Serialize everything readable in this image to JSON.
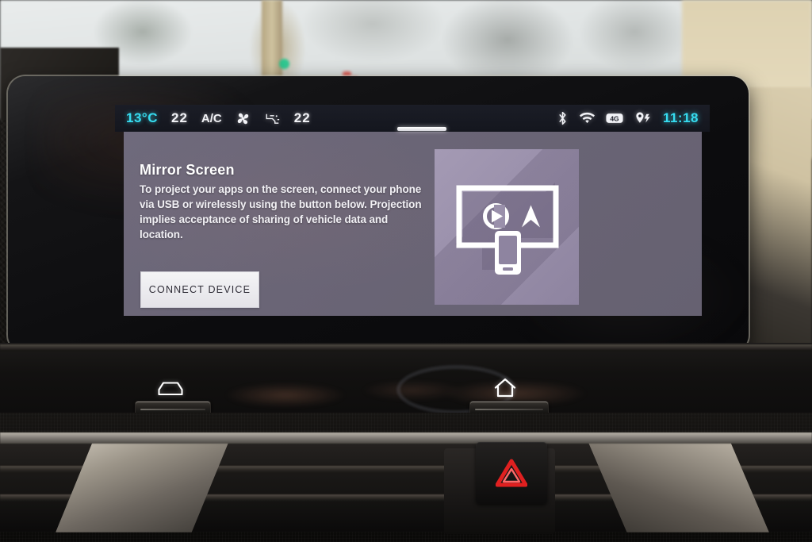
{
  "statusbar": {
    "temperature": "13°C",
    "left_temp_setting": "22",
    "ac_label": "A/C",
    "fan_icon": "fan-icon",
    "airflow_icon": "airflow-direction-icon",
    "right_temp_setting": "22",
    "bluetooth_icon": "bluetooth-icon",
    "wifi_icon": "wifi-icon",
    "network_icon": "4g-signal-icon",
    "location_icon": "location-eco-icon",
    "clock": "11:18"
  },
  "panel": {
    "tab_indicator": "page-indicator",
    "title": "Mirror Screen",
    "description": "To project your apps on the screen, connect your phone via USB or wirelessly using the button below. Projection implies acceptance of sharing of vehicle data and location.",
    "connect_button": "CONNECT DEVICE",
    "illustration": {
      "name": "mirror-screen-illustration",
      "display_icon": "display-screen-icon",
      "carplay_icon": "carplay-icon",
      "androidauto_icon": "android-auto-icon",
      "phone_icon": "smartphone-icon"
    }
  },
  "hardware": {
    "car_button_icon": "car-icon",
    "home_button_icon": "home-icon",
    "left_slider": "left-slider-control",
    "right_slider": "right-slider-control",
    "hazard_button_icon": "hazard-warning-triangle-icon"
  },
  "colors": {
    "accent_cyan": "#36dcf0",
    "panel_bg": "#6a6576",
    "illustration_bg": "#9a90ab",
    "button_bg": "#f4f4f6",
    "hazard_red": "#e02020"
  }
}
